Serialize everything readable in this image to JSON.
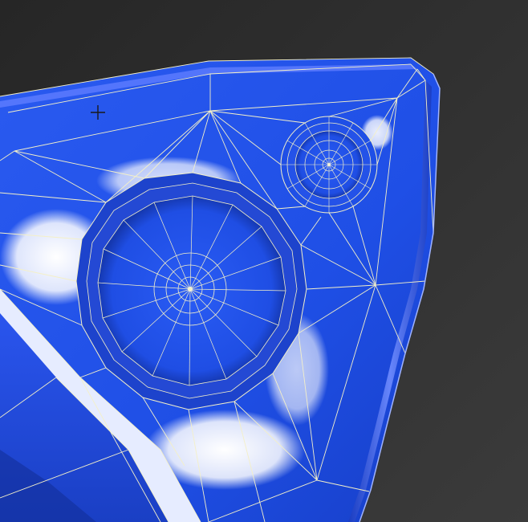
{
  "viewport": {
    "background_color": "#2f2f2f",
    "mesh_color": "#1f4fe6",
    "mesh_highlight_color": "#ffffff",
    "wireframe_color": "#f4f0c8",
    "cursor_icon": "crosshair-cursor-icon"
  }
}
